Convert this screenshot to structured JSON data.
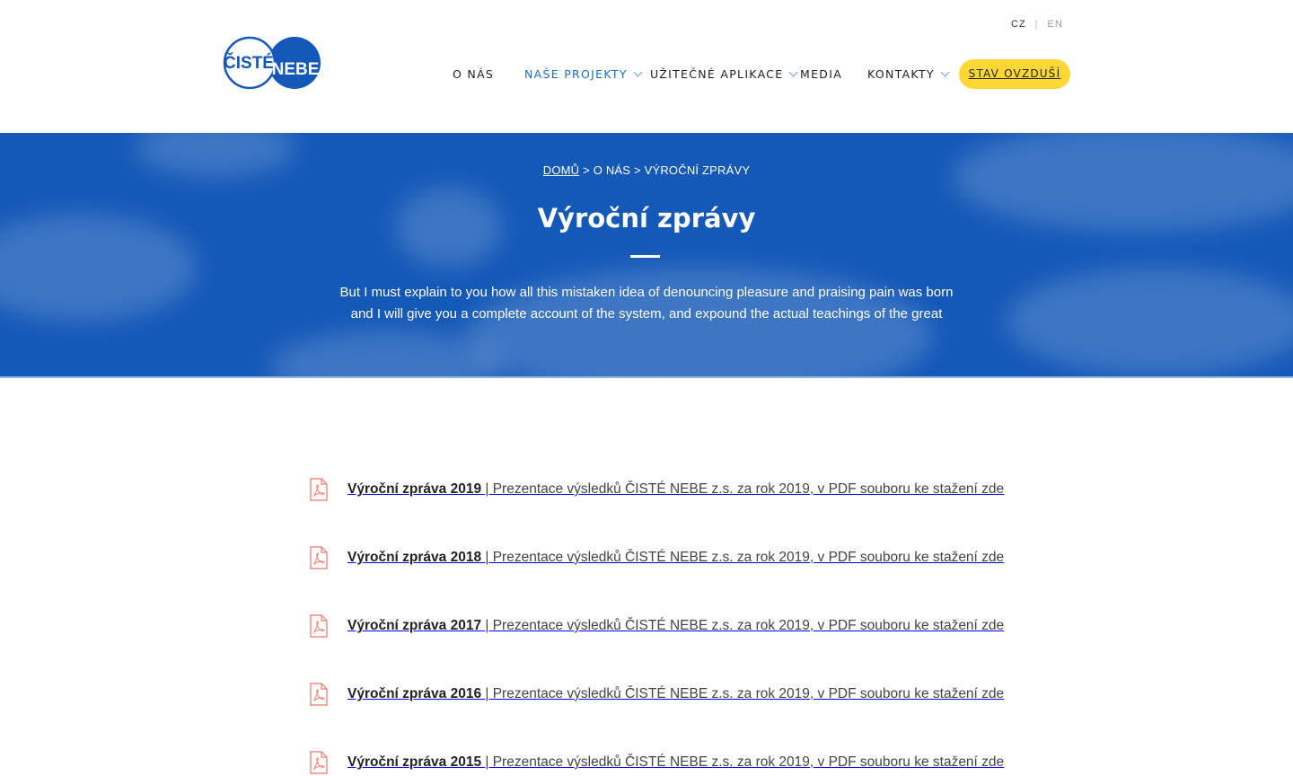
{
  "header": {
    "logo_top": "ČISTÉ",
    "logo_bottom": "NEBE",
    "lang_active": "CZ",
    "lang_other": "EN",
    "lang_sep": "|",
    "nav": [
      {
        "label": "O NÁS",
        "active": false,
        "dropdown": false
      },
      {
        "label": "NAŠE PROJEKTY",
        "active": true,
        "dropdown": true
      },
      {
        "label": "UŽITEČNÉ APLIKACE",
        "active": false,
        "dropdown": true
      },
      {
        "label": "MEDIA",
        "active": false,
        "dropdown": false
      },
      {
        "label": "KONTAKTY",
        "active": false,
        "dropdown": true
      }
    ],
    "cta": "STAV OVZDUŠÍ"
  },
  "hero": {
    "breadcrumb_home": "DOMŮ",
    "breadcrumb_sep1": ">",
    "breadcrumb_about": "O NÁS",
    "breadcrumb_sep2": ">",
    "breadcrumb_current": "VÝROČNÍ ZPRÁVY",
    "title": "Výroční zprávy",
    "lead_line1": "But I must explain to you how all this mistaken idea of denouncing pleasure and praising pain was born",
    "lead_line2": "and I will give you a complete account of the system, and expound the actual teachings of the great"
  },
  "reports": [
    {
      "title": "Výroční zpráva 2019",
      "desc": "| Prezentace výsledků ČISTÉ NEBE z.s. za rok 2019, v PDF souboru ke stažení zde"
    },
    {
      "title": "Výroční zpráva 2018",
      "desc": "| Prezentace výsledků ČISTÉ NEBE z.s. za rok 2019, v PDF souboru ke stažení zde"
    },
    {
      "title": "Výroční zpráva 2017",
      "desc": "| Prezentace výsledků ČISTÉ NEBE z.s. za rok 2019, v PDF souboru ke stažení zde"
    },
    {
      "title": "Výroční zpráva 2016",
      "desc": "| Prezentace výsledků ČISTÉ NEBE z.s. za rok 2019, v PDF souboru ke stažení zde"
    },
    {
      "title": "Výroční zpráva 2015",
      "desc": "| Prezentace výsledků ČISTÉ NEBE z.s. za rok 2019, v PDF souboru ke stažení zde"
    }
  ],
  "colors": {
    "brand_blue": "#1458b8",
    "nav_active": "#1a6fc9",
    "cta_yellow": "#fdd835",
    "pdf_icon": "#ef8a80"
  },
  "icons": {
    "report_icon": "pdf-file-icon",
    "dropdown_icon": "chevron-down-icon"
  }
}
